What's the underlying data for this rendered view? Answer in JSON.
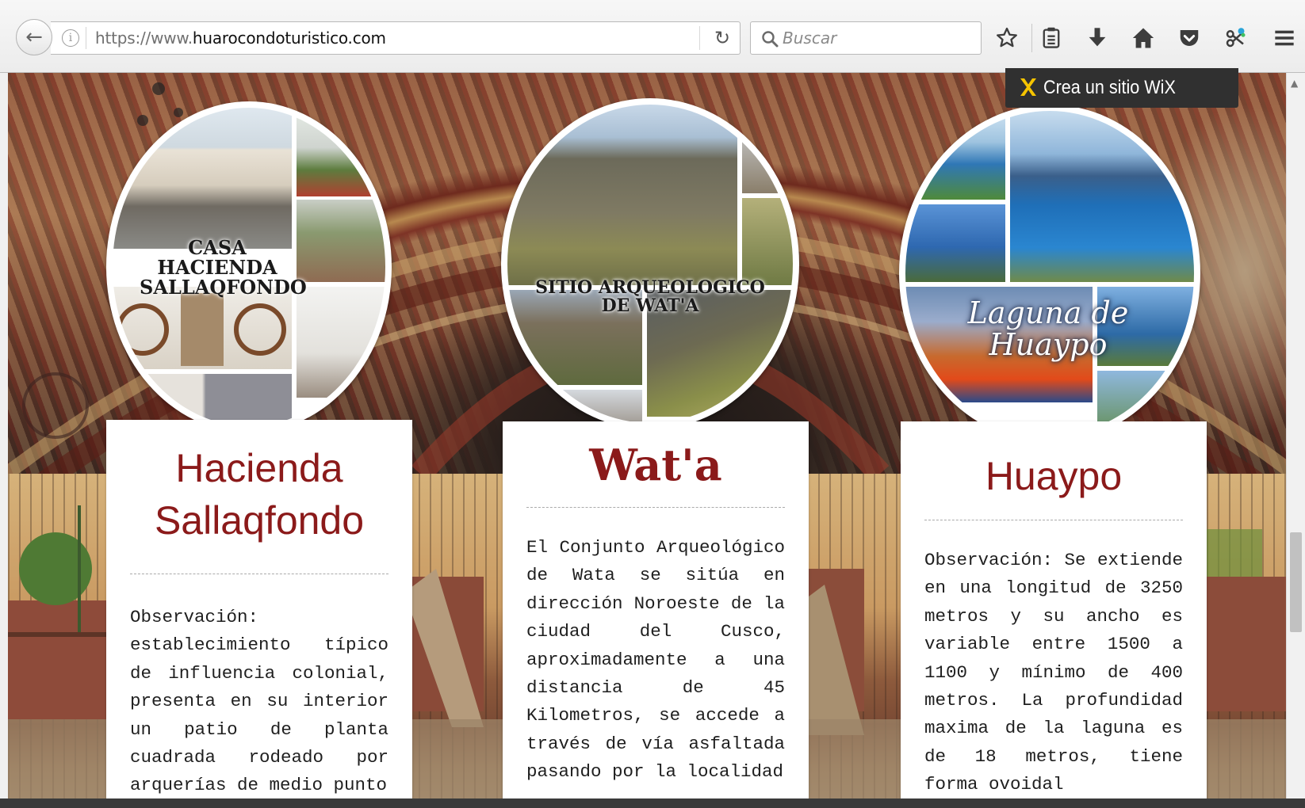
{
  "browser": {
    "url_prefix": "https://www.",
    "url_domain": "huarocondoturistico.com",
    "search_placeholder": "Buscar"
  },
  "wix_banner": {
    "text": "Crea un sitio WiX"
  },
  "cards": [
    {
      "circle_caption": "CASA HACIENDA SALLAQFONDO",
      "title": "Hacienda Sallaqfondo",
      "body": "Observación: establecimiento típico de influencia colonial, presenta en su interior un patio de planta cuadrada rodeado por arquerías de medio punto"
    },
    {
      "circle_caption": "SITIO ARQUEOLOGICO DE WAT'A",
      "title": "Wat'a",
      "body": "El Conjunto Arqueológico de Wata se sitúa en dirección Noroeste de la ciudad del Cusco, aproximadamente a una distancia de 45 Kilometros, se accede a través de vía asfaltada pasando por la localidad"
    },
    {
      "circle_caption": "Laguna de Huaypo",
      "title": "Huaypo",
      "body": "Observación: Se extiende en una longitud de 3250 metros y su ancho es variable entre 1500 a 1100 y mínimo de 400 metros. La profundidad maxima de la laguna es de 18 metros, tiene forma ovoidal"
    }
  ],
  "colors": {
    "title_red": "#8b1a1a",
    "chrome_bg": "#ececec",
    "wix_bar": "#303030"
  }
}
